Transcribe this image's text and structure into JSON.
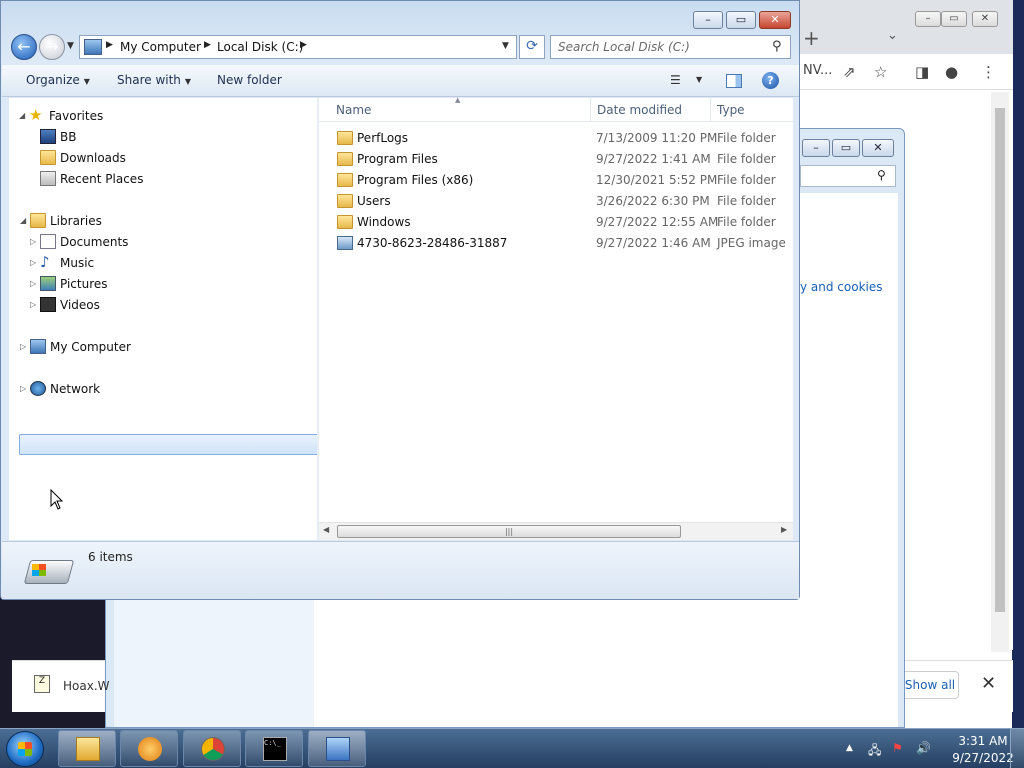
{
  "chrome": {
    "window_min": "–",
    "window_max": "▭",
    "window_close": "✕",
    "new_tab": "+",
    "tab_list": "⌄",
    "address_fragment": "NV...",
    "link_text": "y and cookies",
    "show_all": "Show all",
    "download_close": "✕",
    "download_name": "Hoax.W",
    "icons": [
      "share-icon",
      "star-icon",
      "sidebar-icon",
      "profile-icon",
      "menu-icon"
    ]
  },
  "explorer": {
    "address": {
      "crumbs": [
        "My Computer",
        "Local Disk (C:)"
      ]
    },
    "search_placeholder": "Search Local Disk (C:)",
    "toolbar": {
      "organize": "Organize",
      "share_with": "Share with",
      "new_folder": "New folder"
    },
    "nav": {
      "favorites": "Favorites",
      "bb": "BB",
      "downloads": "Downloads",
      "recent_places": "Recent Places",
      "libraries": "Libraries",
      "documents": "Documents",
      "music": "Music",
      "pictures": "Pictures",
      "videos": "Videos",
      "my_computer": "My Computer",
      "network": "Network"
    },
    "columns": {
      "name": "Name",
      "date_modified": "Date modified",
      "type": "Type"
    },
    "files": [
      {
        "name": "PerfLogs",
        "date": "7/13/2009 11:20 PM",
        "type": "File folder",
        "icon": "folder-icon"
      },
      {
        "name": "Program Files",
        "date": "9/27/2022 1:41 AM",
        "type": "File folder",
        "icon": "folder-icon"
      },
      {
        "name": "Program Files (x86)",
        "date": "12/30/2021 5:52 PM",
        "type": "File folder",
        "icon": "folder-icon"
      },
      {
        "name": "Users",
        "date": "3/26/2022 6:30 PM",
        "type": "File folder",
        "icon": "folder-icon"
      },
      {
        "name": "Windows",
        "date": "9/27/2022 12:55 AM",
        "type": "File folder",
        "icon": "folder-icon"
      },
      {
        "name": "4730-8623-28486-31887",
        "date": "9/27/2022 1:46 AM",
        "type": "JPEG image",
        "icon": "image-file-icon"
      }
    ],
    "status": "6 items"
  },
  "taskbar": {
    "apps": [
      "explorer-icon",
      "media-player-icon",
      "chrome-icon",
      "cmd-icon",
      "control-panel-icon"
    ],
    "time": "3:31 AM",
    "date": "9/27/2022"
  }
}
